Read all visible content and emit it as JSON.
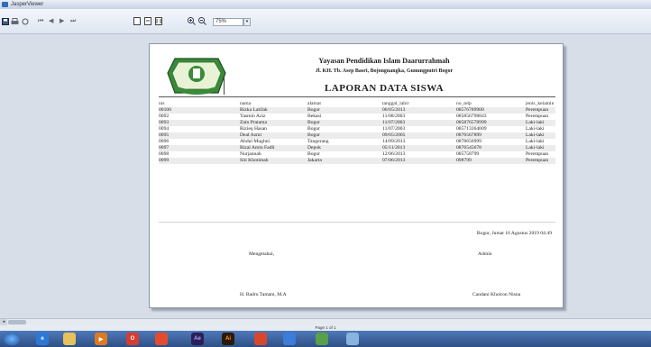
{
  "window": {
    "title": "JasperViewer"
  },
  "toolbar": {
    "zoom_value": "75%",
    "nav_first": "⏮",
    "nav_prev": "◀",
    "nav_next": "▶",
    "nav_last": "⏭"
  },
  "report": {
    "org_name": "Yayasan Pendidikan Islam Daarurrahmah",
    "address": "Jl. KH. Tb. Asep Basri, Bojongnangka, Gunungputri Bogor",
    "title": "LAPORAN DATA SISWA",
    "columns": [
      "nis",
      "nama",
      "alamat",
      "tanggal_lahir",
      "no_telp",
      "jenis_kelamin"
    ],
    "rows": [
      [
        "00100",
        "Rizka Latifah",
        "Bogor",
        "06/05/2013",
        "08576789900",
        "Perempuan"
      ],
      [
        "0092",
        "Yasmin Aziz",
        "Bekasi",
        "11/08/2003",
        "085856798843",
        "Perempuan"
      ],
      [
        "0093",
        "Zain Pratama",
        "Bogor",
        "11/07/2003",
        "085876578999",
        "Laki-laki"
      ],
      [
        "0094",
        "Rizieq Hasan",
        "Bogor",
        "11/07/2003",
        "085713364009",
        "Laki-laki"
      ],
      [
        "0095",
        "Deal Azmi",
        "Bogor",
        "09/05/2005",
        "0876567899",
        "Laki-laki"
      ],
      [
        "0096",
        "Abdul Mughni",
        "Tangerang",
        "14/09/2013",
        "0878656999",
        "Laki-laki"
      ],
      [
        "0097",
        "Rizal Amin Fadli",
        "Depok",
        "05/11/2013",
        "0876545678",
        "Laki-laki"
      ],
      [
        "0098",
        "Nurjannah",
        "Bogor",
        "12/06/2013",
        "085758799",
        "Perempuan"
      ],
      [
        "0099",
        "Siti Khotimah",
        "Jakarta",
        "07/06/2013",
        "098799",
        "Perempuan"
      ]
    ],
    "print_date": "Bogor, Jumat 16 Agustus 2019 04:49",
    "left_label": "Mengetahui,",
    "right_label": "Admin",
    "left_name": "H. Badru Tamam, M.A",
    "right_name": "Candani Khoiron Nisna"
  },
  "status": {
    "page_indicator": "Page 1 of 1"
  },
  "taskbar": {
    "ae_label": "Ae",
    "ai_label": "Ai"
  },
  "colors": {
    "logo_green": "#3a8a3a",
    "taskbar": "#3a5f99"
  }
}
